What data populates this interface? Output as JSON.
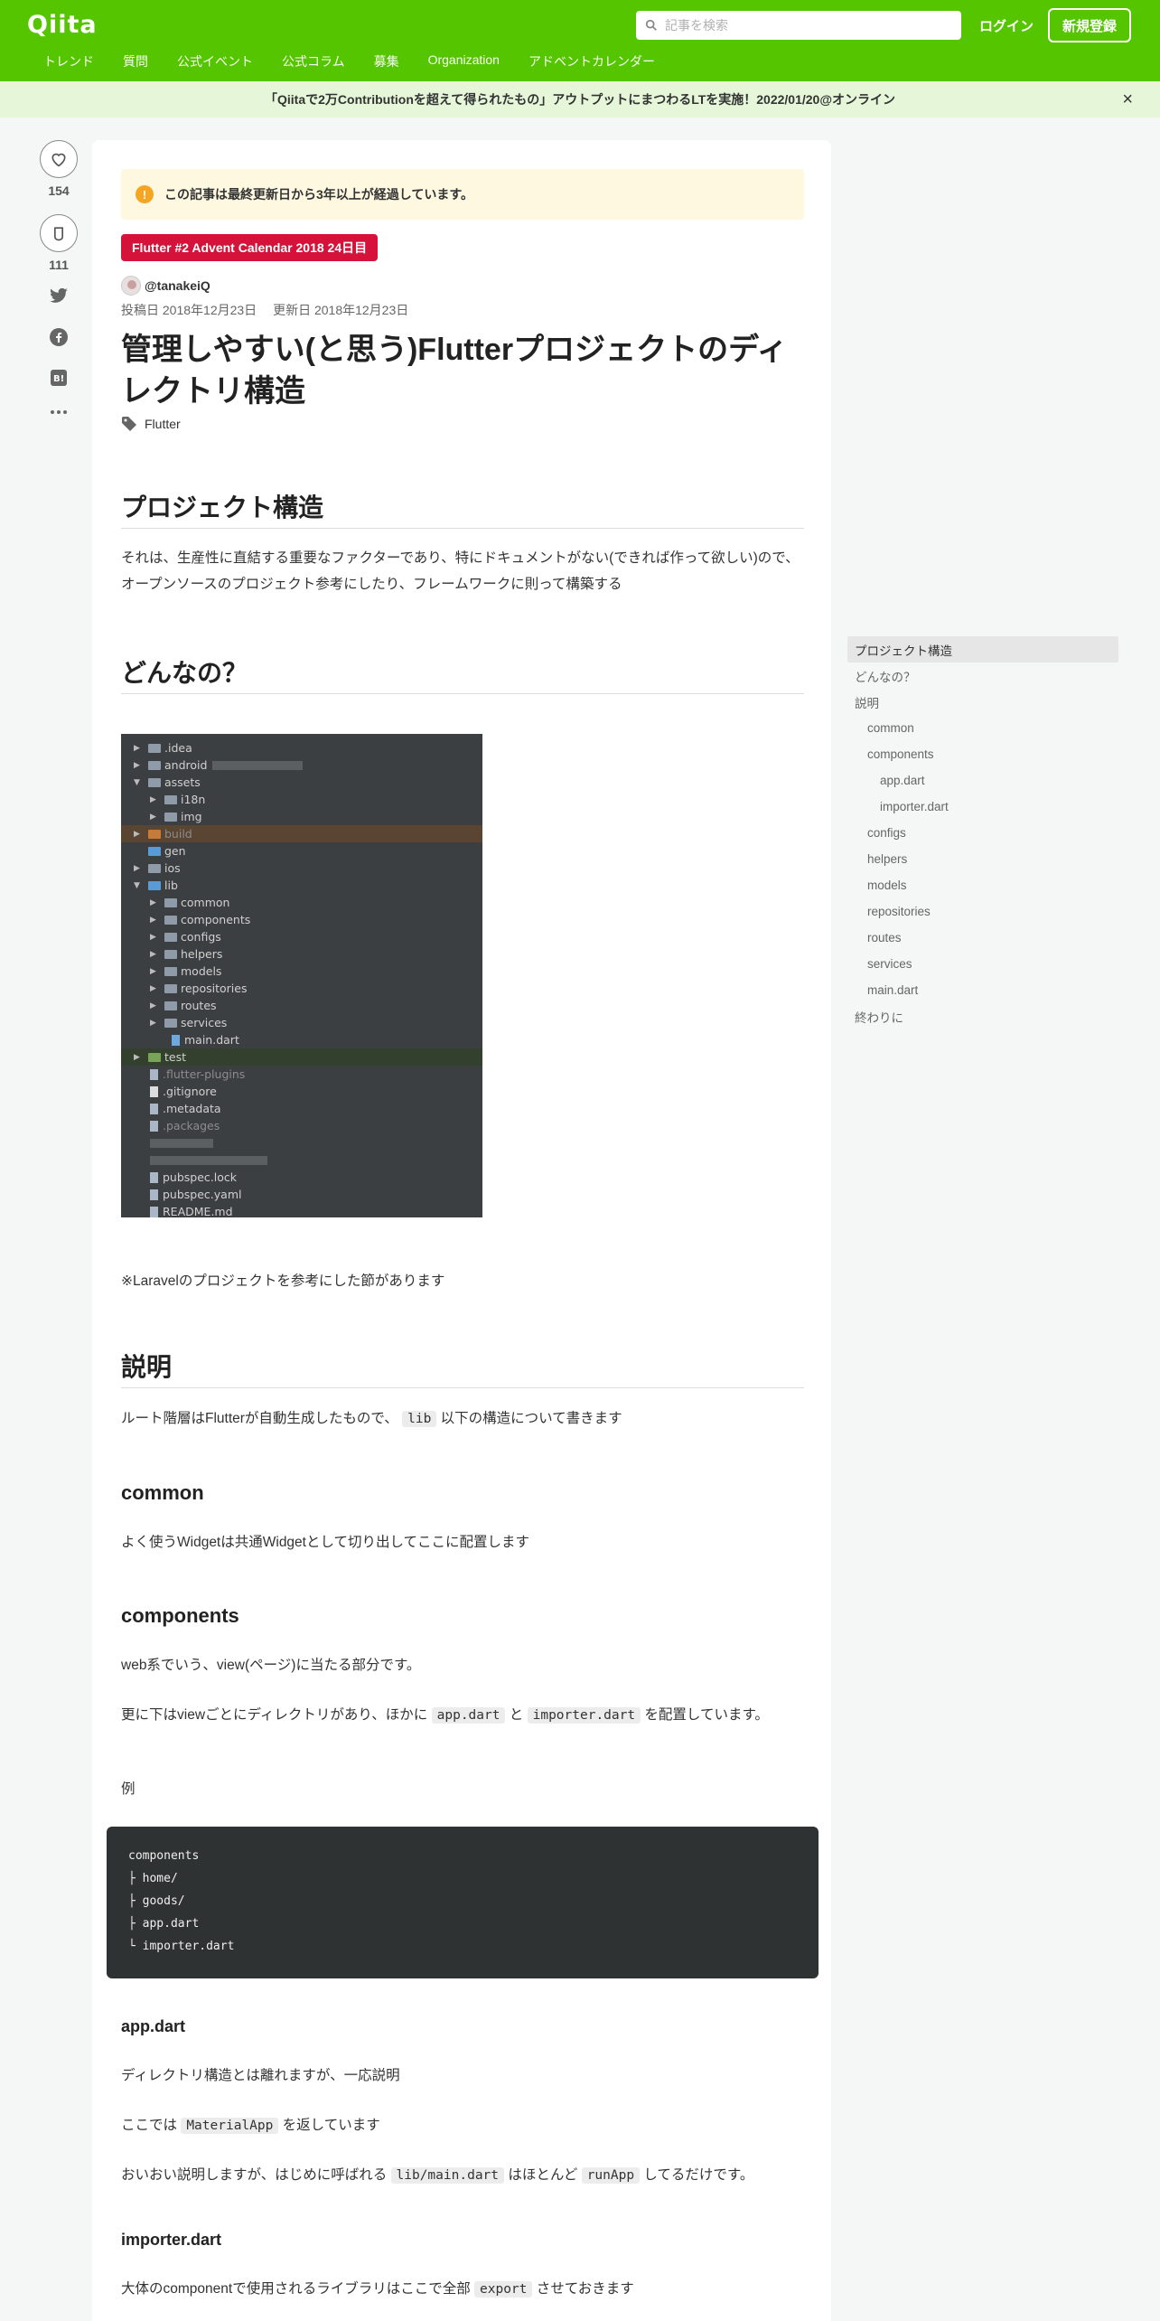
{
  "header": {
    "logo": "Qiita",
    "search_placeholder": "記事を検索",
    "login": "ログイン",
    "signup": "新規登録",
    "nav": [
      "トレンド",
      "質問",
      "公式イベント",
      "公式コラム",
      "募集",
      "Organization",
      "アドベントカレンダー"
    ]
  },
  "banner": {
    "text": "「Qiitaで2万Contributionを超えて得られたもの」アウトプットにまつわるLTを実施！2022/01/20@オンライン",
    "close": "×"
  },
  "actions": {
    "likes": "154",
    "stocks": "111"
  },
  "article": {
    "warning": "この記事は最終更新日から3年以上が経過しています。",
    "advent": "Flutter #2 Advent Calendar 2018 24日目",
    "author": "@tanakeiQ",
    "posted": "投稿日 2018年12月23日",
    "updated": "更新日 2018年12月23日",
    "title": "管理しやすい(と思う)Flutterプロジェクトのディレクトリ構造",
    "tag": "Flutter",
    "h_structure": "プロジェクト構造",
    "p_structure": "それは、生産性に直結する重要なファクターであり、特にドキュメントがない(できれば作って欲しい)ので、オープンソースのプロジェクト参考にしたり、フレームワークに則って構築する",
    "h_donna": "どんなの？",
    "tree": {
      "idea": ".idea",
      "android": "android",
      "assets": "assets",
      "i18n": "i18n",
      "img": "img",
      "build": "build",
      "gen": "gen",
      "ios": "ios",
      "lib": "lib",
      "common": "common",
      "components": "components",
      "configs": "configs",
      "helpers": "helpers",
      "models": "models",
      "repositories": "repositories",
      "routes": "routes",
      "services": "services",
      "main": "main.dart",
      "test": "test",
      "flutter_plugins": ".flutter-plugins",
      "gitignore": ".gitignore",
      "metadata": ".metadata",
      "packages": ".packages",
      "pubspec_lock": "pubspec.lock",
      "pubspec_yaml": "pubspec.yaml",
      "readme": "README.md"
    },
    "note_laravel": "※Laravelのプロジェクトを参考にした節があります",
    "h_setsumei": "説明",
    "p_root_a": "ルート階層はFlutterが自動生成したもので、",
    "p_root_code": "lib",
    "p_root_b": "以下の構造について書きます",
    "h_common": "common",
    "p_common": "よく使うWidgetは共通Widgetとして切り出してここに配置します",
    "h_components": "components",
    "p_comp1": "web系でいう、view(ページ)に当たる部分です。",
    "p_comp2_a": "更に下はviewごとにディレクトリがあり、ほかに",
    "p_comp2_code1": "app.dart",
    "p_comp2_and": "と",
    "p_comp2_code2": "importer.dart",
    "p_comp2_b": "を配置しています。",
    "p_example": "例",
    "code": "components\n├ home/\n├ goods/\n├ app.dart\n└ importer.dart",
    "h_appdart": "app.dart",
    "p_app1": "ディレクトリ構造とは離れますが、一応説明",
    "p_app2_a": "ここでは",
    "p_app2_code": "MaterialApp",
    "p_app2_b": "を返しています",
    "p_app3_a": "おいおい説明しますが、はじめに呼ばれる",
    "p_app3_code1": "lib/main.dart",
    "p_app3_mid": "はほとんど",
    "p_app3_code2": "runApp",
    "p_app3_b": "してるだけです。",
    "h_importer": "importer.dart",
    "p_imp_a": "大体のcomponentで使用されるライブラリはここで全部",
    "p_imp_code": "export",
    "p_imp_b": "させておきます"
  },
  "toc": [
    {
      "label": "プロジェクト構造",
      "level": 1,
      "active": true
    },
    {
      "label": "どんなの？",
      "level": 1
    },
    {
      "label": "説明",
      "level": 1
    },
    {
      "label": "common",
      "level": 2
    },
    {
      "label": "components",
      "level": 2
    },
    {
      "label": "app.dart",
      "level": 3
    },
    {
      "label": "importer.dart",
      "level": 3
    },
    {
      "label": "configs",
      "level": 2
    },
    {
      "label": "helpers",
      "level": 2
    },
    {
      "label": "models",
      "level": 2
    },
    {
      "label": "repositories",
      "level": 2
    },
    {
      "label": "routes",
      "level": 2
    },
    {
      "label": "services",
      "level": 2
    },
    {
      "label": "main.dart",
      "level": 2
    },
    {
      "label": "終わりに",
      "level": 1
    }
  ]
}
